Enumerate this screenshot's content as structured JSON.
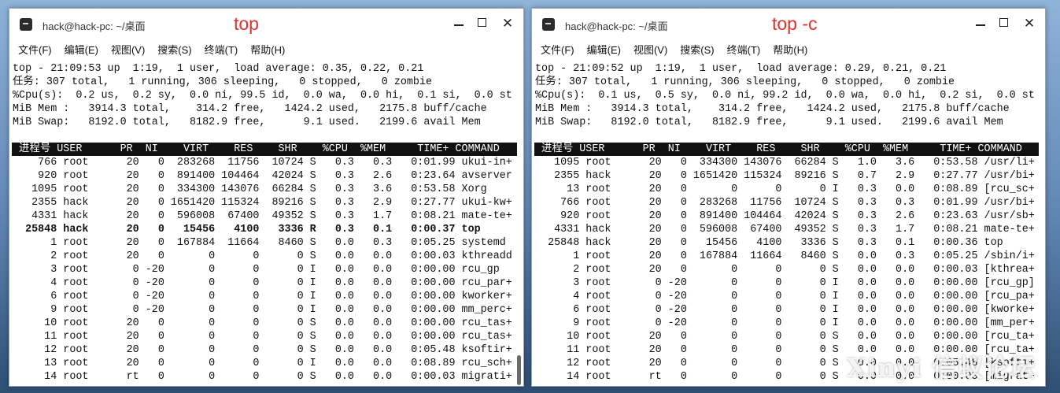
{
  "windows": [
    {
      "title": "hack@hack-pc: ~/桌面",
      "label": "top",
      "menu": [
        "文件(F)",
        "编辑(E)",
        "视图(V)",
        "搜索(S)",
        "终端(T)",
        "帮助(H)"
      ],
      "summary": [
        "top - 21:09:53 up  1:19,  1 user,  load average: 0.35, 0.22, 0.21",
        "任务: 307 total,   1 running, 306 sleeping,   0 stopped,   0 zombie",
        "%Cpu(s):  0.2 us,  0.2 sy,  0.0 ni, 99.5 id,  0.0 wa,  0.0 hi,  0.1 si,  0.0 st",
        "MiB Mem :   3914.3 total,    314.2 free,   1424.2 used,   2175.8 buff/cache",
        "MiB Swap:   8192.0 total,   8182.9 free,      9.1 used.   2199.6 avail Mem"
      ],
      "header": " 进程号 USER      PR  NI    VIRT    RES    SHR    %CPU  %MEM     TIME+ COMMAND",
      "rows": [
        "    766 root      20   0  283268  11756  10724 S   0.3   0.3   0:01.99 ukui-in+",
        "    920 root      20   0  891400 104464  42024 S   0.3   2.6   0:23.64 avserver",
        "   1095 root      20   0  334300 143076  66284 S   0.3   3.6   0:53.58 Xorg",
        "   2355 hack      20   0 1651420 115324  89216 S   0.3   2.9   0:27.77 ukui-kw+",
        "   4331 hack      20   0  596008  67400  49352 S   0.3   1.7   0:08.21 mate-te+",
        "  25848 hack      20   0   15456   4100   3336 R   0.3   0.1   0:00.37 top",
        "      1 root      20   0  167884  11664   8460 S   0.0   0.3   0:05.25 systemd",
        "      2 root      20   0       0      0      0 S   0.0   0.0   0:00.03 kthreadd",
        "      3 root       0 -20       0      0      0 I   0.0   0.0   0:00.00 rcu_gp",
        "      4 root       0 -20       0      0      0 I   0.0   0.0   0:00.00 rcu_par+",
        "      6 root       0 -20       0      0      0 I   0.0   0.0   0:00.00 kworker+",
        "      9 root       0 -20       0      0      0 I   0.0   0.0   0:00.00 mm_perc+",
        "     10 root      20   0       0      0      0 S   0.0   0.0   0:00.00 rcu_tas+",
        "     11 root      20   0       0      0      0 S   0.0   0.0   0:00.00 rcu_tas+",
        "     12 root      20   0       0      0      0 S   0.0   0.0   0:05.48 ksoftir+",
        "     13 root      20   0       0      0      0 I   0.0   0.0   0:08.89 rcu_sch+",
        "     14 root      rt   0       0      0      0 S   0.0   0.0   0:00.03 migrati+"
      ]
    },
    {
      "title": "hack@hack-pc: ~/桌面",
      "label": "top -c",
      "menu": [
        "文件(F)",
        "编辑(E)",
        "视图(V)",
        "搜索(S)",
        "终端(T)",
        "帮助(H)"
      ],
      "summary": [
        "top - 21:09:52 up  1:19,  1 user,  load average: 0.29, 0.21, 0.21",
        "任务: 307 total,   1 running, 306 sleeping,   0 stopped,   0 zombie",
        "%Cpu(s):  0.1 us,  0.5 sy,  0.0 ni, 99.2 id,  0.0 wa,  0.0 hi,  0.2 si,  0.0 st",
        "MiB Mem :   3914.3 total,    314.2 free,   1424.2 used,   2175.8 buff/cache",
        "MiB Swap:   8192.0 total,   8182.9 free,      9.1 used.   2199.6 avail Mem"
      ],
      "header": " 进程号 USER      PR  NI    VIRT    RES    SHR    %CPU  %MEM     TIME+ COMMAND",
      "rows": [
        "   1095 root      20   0  334300 143076  66284 S   1.0   3.6   0:53.58 /usr/li+",
        "   2355 hack      20   0 1651420 115324  89216 S   0.7   2.9   0:27.77 /usr/bi+",
        "     13 root      20   0       0      0      0 I   0.3   0.0   0:08.89 [rcu_sc+",
        "    766 root      20   0  283268  11756  10724 S   0.3   0.3   0:01.99 /usr/bi+",
        "    920 root      20   0  891400 104464  42024 S   0.3   2.6   0:23.63 /usr/sb+",
        "   4331 hack      20   0  596008  67400  49352 S   0.3   1.7   0:08.21 mate-te+",
        "  25848 hack      20   0   15456   4100   3336 S   0.3   0.1   0:00.36 top",
        "      1 root      20   0  167884  11664   8460 S   0.0   0.3   0:05.25 /sbin/i+",
        "      2 root      20   0       0      0      0 S   0.0   0.0   0:00.03 [kthrea+",
        "      3 root       0 -20       0      0      0 I   0.0   0.0   0:00.00 [rcu_gp]",
        "      4 root       0 -20       0      0      0 I   0.0   0.0   0:00.00 [rcu_pa+",
        "      6 root       0 -20       0      0      0 I   0.0   0.0   0:00.00 [kworke+",
        "      9 root       0 -20       0      0      0 I   0.0   0.0   0:00.00 [mm_per+",
        "     10 root      20   0       0      0      0 S   0.0   0.0   0:00.00 [rcu_ta+",
        "     11 root      20   0       0      0      0 S   0.0   0.0   0:00.00 [rcu_ta+",
        "     12 root      20   0       0      0      0 S   0.0   0.0   0:05.48 [ksofti+",
        "     14 root      rt   0       0      0      0 S   0.0   0.0   0:00.03 [migrat+"
      ]
    }
  ],
  "watermark": "Xinyi 信蚁论坛"
}
